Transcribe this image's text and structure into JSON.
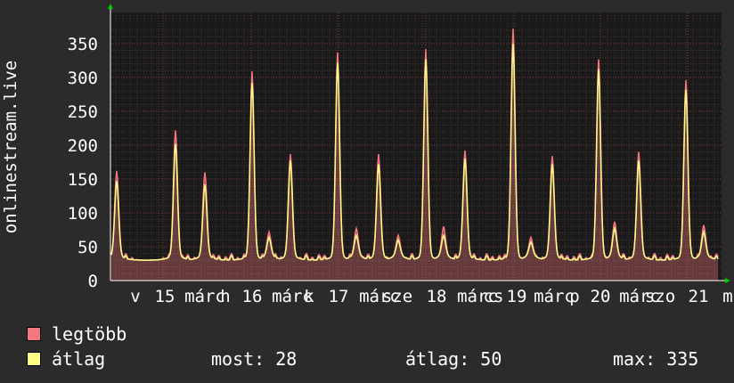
{
  "chart_data": {
    "type": "line",
    "ylabel": "onlinestream.live",
    "ylim": [
      0,
      380
    ],
    "y_ticks": [
      0,
      50,
      100,
      150,
      200,
      250,
      300,
      350
    ],
    "x_tick_labels": [
      "v",
      "15",
      "márc",
      "h",
      "16",
      "márc",
      "k",
      "17",
      "márc",
      "sze",
      "18",
      "márc",
      "cs",
      "19",
      "márc",
      "p",
      "20",
      "márc",
      "szo",
      "21",
      "m"
    ],
    "grid": true,
    "colors": {
      "max": "#f4777f",
      "avg": "#ffff88",
      "plot_bg": "#1a1a1a",
      "grid_major": "#8a3a3a",
      "grid_minor": "#4a3535"
    },
    "peaks": [
      {
        "x": 131,
        "max": 150,
        "avg": 135
      },
      {
        "x": 197,
        "max": 210,
        "avg": 190
      },
      {
        "x": 230,
        "max": 148,
        "avg": 130
      },
      {
        "x": 283,
        "max": 297,
        "avg": 280
      },
      {
        "x": 302,
        "max": 60,
        "avg": 52
      },
      {
        "x": 326,
        "max": 175,
        "avg": 165
      },
      {
        "x": 379,
        "max": 325,
        "avg": 310
      },
      {
        "x": 400,
        "max": 65,
        "avg": 55
      },
      {
        "x": 425,
        "max": 175,
        "avg": 160
      },
      {
        "x": 447,
        "max": 55,
        "avg": 48
      },
      {
        "x": 478,
        "max": 330,
        "avg": 315
      },
      {
        "x": 498,
        "max": 68,
        "avg": 55
      },
      {
        "x": 522,
        "max": 180,
        "avg": 168
      },
      {
        "x": 576,
        "max": 360,
        "avg": 338
      },
      {
        "x": 596,
        "max": 52,
        "avg": 45
      },
      {
        "x": 620,
        "max": 172,
        "avg": 160
      },
      {
        "x": 672,
        "max": 315,
        "avg": 300
      },
      {
        "x": 690,
        "max": 75,
        "avg": 65
      },
      {
        "x": 717,
        "max": 178,
        "avg": 165
      },
      {
        "x": 770,
        "max": 284,
        "avg": 270
      },
      {
        "x": 790,
        "max": 70,
        "avg": 60
      }
    ],
    "baseline": 30,
    "gap": [
      154,
      178
    ],
    "series": [
      {
        "name": "legtöbb",
        "key": "max"
      },
      {
        "name": "átlag",
        "key": "avg"
      }
    ]
  },
  "legend": {
    "max_label": "legtöbb",
    "avg_label": "átlag",
    "now": "most: 28",
    "average": "átlag: 50",
    "maximum": "max: 335"
  }
}
